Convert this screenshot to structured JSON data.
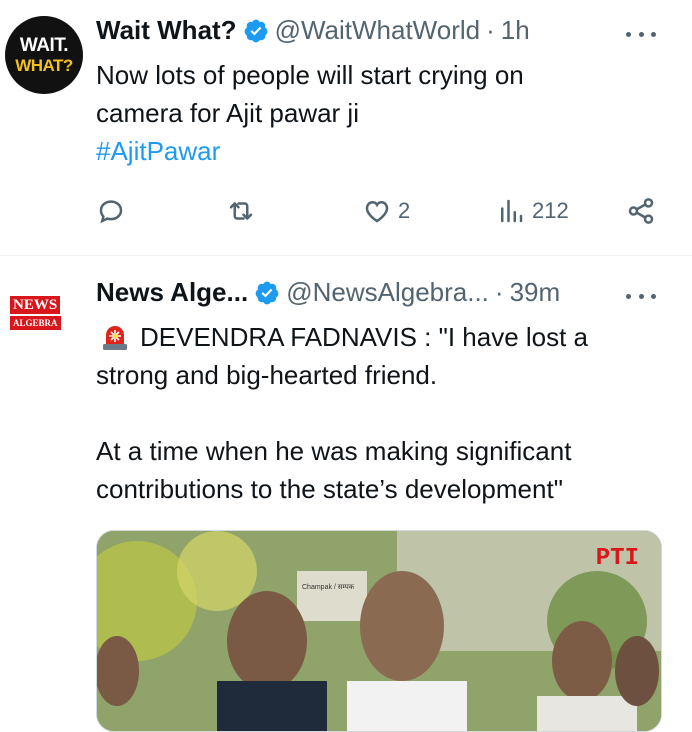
{
  "tweets": [
    {
      "avatar_line1": "WAIT.",
      "avatar_line2": "WHAT?",
      "name": "Wait What?",
      "handle": "@WaitWhatWorld",
      "separator": "·",
      "time": "1h",
      "text": "Now lots of people will start crying on\ncamera for Ajit pawar ji",
      "hashtag": "#AjitPawar",
      "actions": {
        "reply_icon": "reply-icon",
        "retweet_icon": "retweet-icon",
        "like_icon": "heart-icon",
        "like_count": "2",
        "views_icon": "views-icon",
        "views_count": "212",
        "share_icon": "share-icon"
      }
    },
    {
      "avatar_line1": "NEWS",
      "avatar_line2": "ALGEBRA",
      "name": "News Alge...",
      "handle": "@NewsAlgebra...",
      "separator": "·",
      "time": "39m",
      "emoji_icon": "police-light-icon",
      "text": "DEVENDRA FADNAVIS : \"I have lost a\nstrong and big-hearted friend.\n\nAt a time when he was making significant\ncontributions to the state’s development\"",
      "media": {
        "watermark": "PTI",
        "sign_text": "Champak / सम्पक"
      }
    }
  ],
  "colors": {
    "accent": "#1d9bf0",
    "muted": "#536471",
    "text": "#0f1419"
  }
}
